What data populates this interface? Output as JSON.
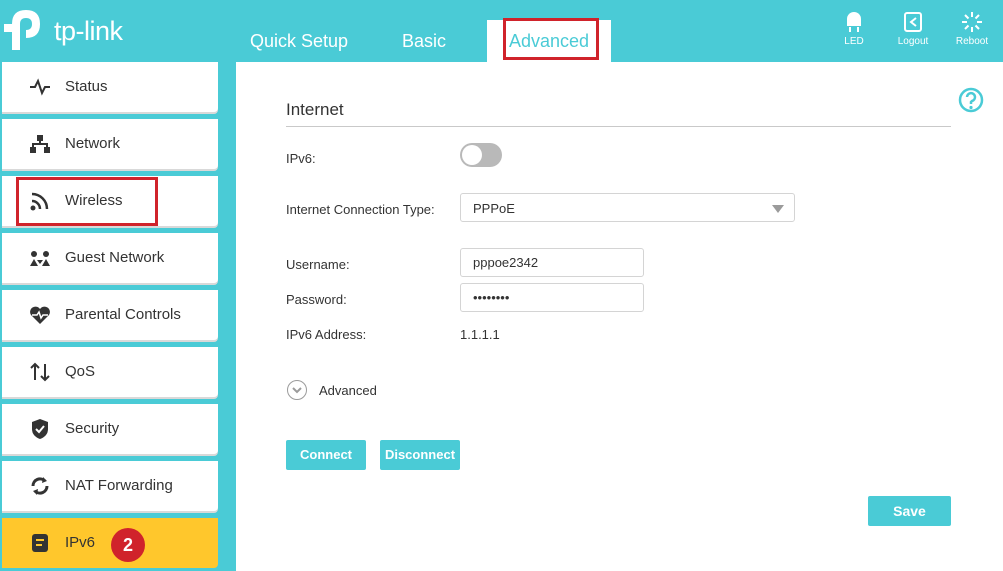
{
  "brand": {
    "name": "tp-link",
    "accent": "#4acbd6",
    "highlight": "#ffc72c",
    "annotation": "#d0232b"
  },
  "nav_tabs": [
    {
      "label": "Quick Setup"
    },
    {
      "label": "Basic"
    },
    {
      "label": "Advanced",
      "selected": true
    }
  ],
  "header_actions": [
    {
      "label": "LED",
      "icon": "bulb-icon"
    },
    {
      "label": "Logout",
      "icon": "logout-icon"
    },
    {
      "label": "Reboot",
      "icon": "reboot-icon"
    }
  ],
  "sidebar": {
    "items": [
      {
        "label": "Status",
        "icon": "pulse-icon"
      },
      {
        "label": "Network",
        "icon": "network-icon"
      },
      {
        "label": "Wireless",
        "icon": "wifi-icon"
      },
      {
        "label": "Guest Network",
        "icon": "guest-icon"
      },
      {
        "label": "Parental Controls",
        "icon": "heart-icon"
      },
      {
        "label": "QoS",
        "icon": "qos-icon"
      },
      {
        "label": "Security",
        "icon": "shield-icon"
      },
      {
        "label": "NAT Forwarding",
        "icon": "nat-icon"
      },
      {
        "label": "IPv6",
        "icon": "ipv6-icon",
        "active": true,
        "badge": "2"
      }
    ]
  },
  "internet": {
    "title": "Internet",
    "ipv6_label": "IPv6:",
    "ipv6_enabled": false,
    "conn_type_label": "Internet Connection Type:",
    "conn_type_value": "PPPoE",
    "username_label": "Username:",
    "username_value": "pppoe2342",
    "password_label": "Password:",
    "password_value": "••••••••",
    "ipv6_address_label": "IPv6 Address:",
    "ipv6_address_value": "1.1.1.1",
    "advanced_label": "Advanced",
    "connect_label": "Connect",
    "disconnect_label": "Disconnect",
    "save_label": "Save"
  }
}
